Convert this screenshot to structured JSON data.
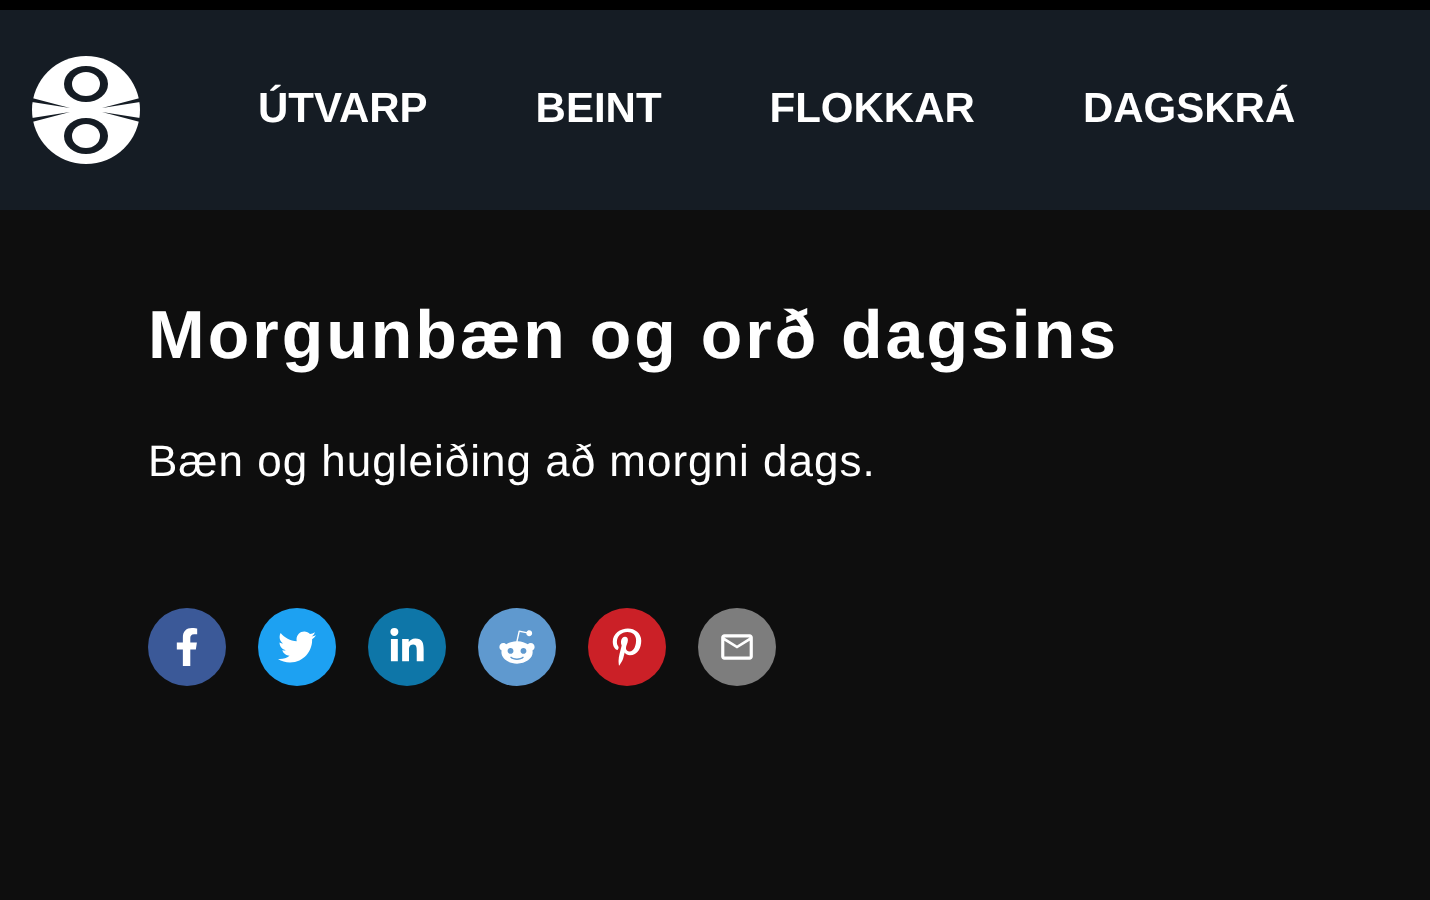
{
  "nav": {
    "items": [
      {
        "label": "ÚTVARP"
      },
      {
        "label": "BEINT"
      },
      {
        "label": "FLOKKAR"
      },
      {
        "label": "DAGSKRÁ"
      }
    ]
  },
  "title": "Morgunbæn og orð dagsins",
  "description": "Bæn og hugleiðing að morgni dags.",
  "share": [
    {
      "kind": "facebook",
      "color": "#3b5998"
    },
    {
      "kind": "twitter",
      "color": "#1da1f2"
    },
    {
      "kind": "linkedin",
      "color": "#0e76a8"
    },
    {
      "kind": "reddit",
      "color": "#5f99cf"
    },
    {
      "kind": "pinterest",
      "color": "#cb2027"
    },
    {
      "kind": "email",
      "color": "#7d7d7d"
    }
  ]
}
